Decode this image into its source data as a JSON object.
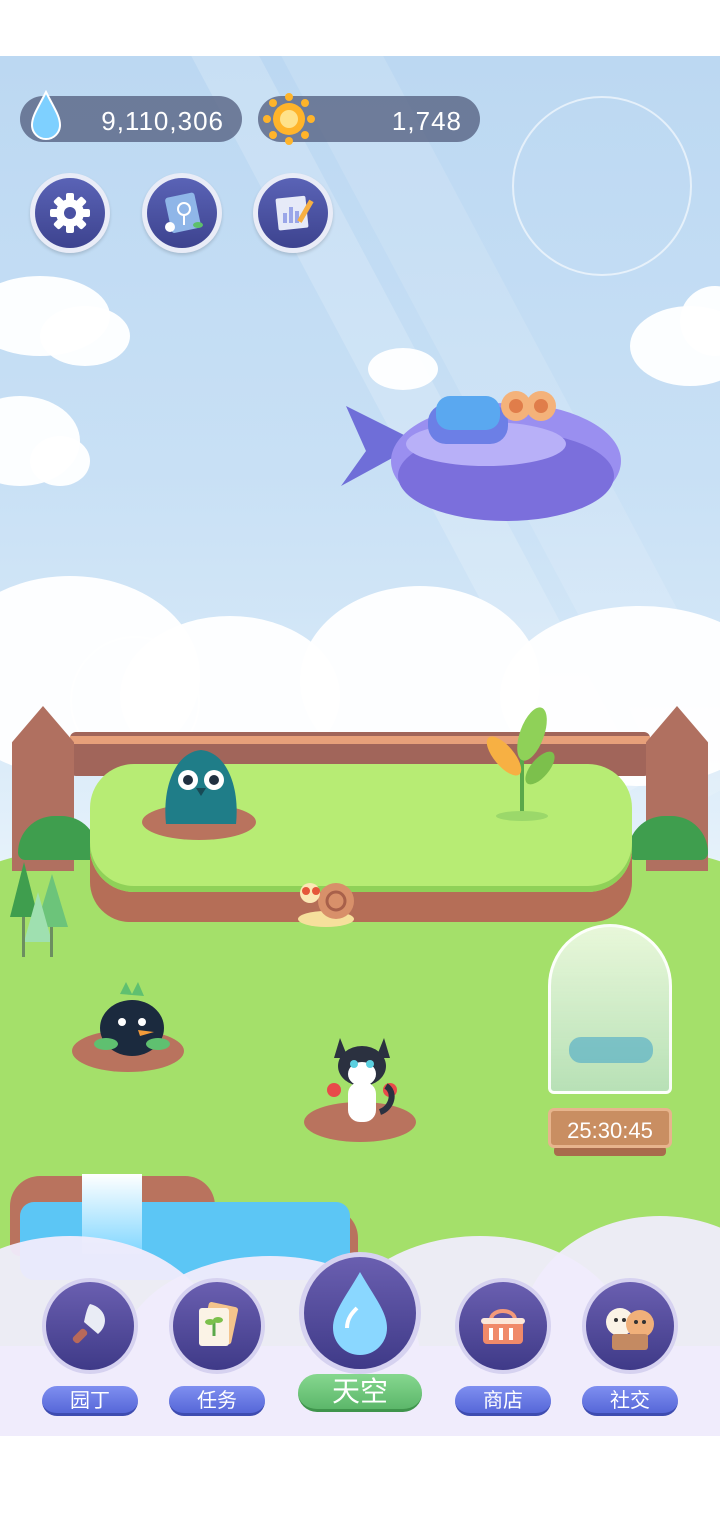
{
  "resources": {
    "water_amount": "9,110,306",
    "sun_amount": "1,748"
  },
  "top_buttons": [
    {
      "icon": "gear-icon",
      "label": "settings"
    },
    {
      "icon": "plant-book-icon",
      "label": "encyclopedia"
    },
    {
      "icon": "notebook-pencil-icon",
      "label": "records"
    }
  ],
  "greenhouse": {
    "timer": "25:30:45"
  },
  "bottom_nav": {
    "gardener": "园丁",
    "tasks": "任务",
    "sky": "天空",
    "shop": "商店",
    "social": "社交"
  },
  "colors": {
    "sky": "#c8e0f5",
    "grass": "#9ee36a",
    "nav_label": "#6677e0",
    "sky_label": "#6cc47a",
    "counter_bg": "#546080"
  }
}
